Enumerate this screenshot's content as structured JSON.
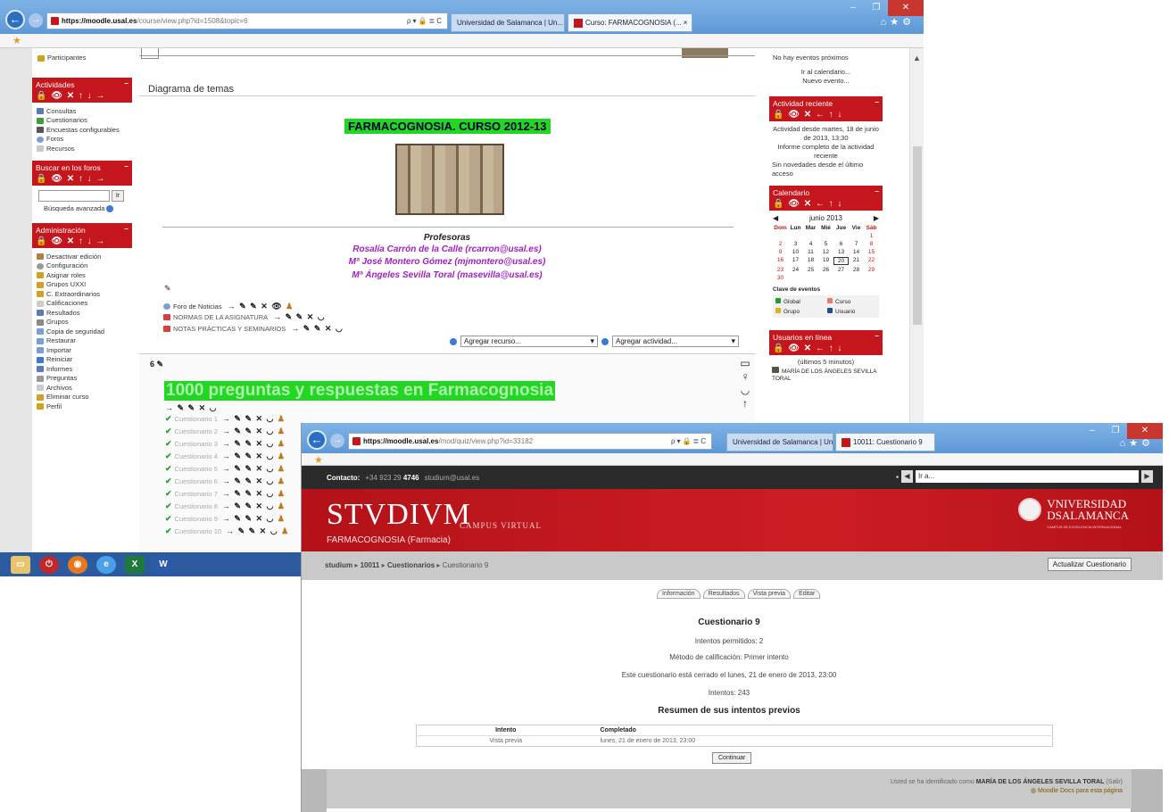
{
  "browser1": {
    "url_host": "https://moodle.usal.es",
    "url_path": "/course/view.php?id=1508&topic=6",
    "addr_ctrls": "ρ▾🔒≣C",
    "tab1": "Universidad de Salamanca | Un...",
    "tab2": "Curso: FARMACOGNOSIA (...  ×"
  },
  "left": {
    "participants": "Participantes",
    "actividades_title": "Actividades",
    "actividades": [
      "Consultas",
      "Cuestionarios",
      "Encuestas configurables",
      "Foros",
      "Recursos"
    ],
    "buscar_title": "Buscar en los foros",
    "search_btn": "Ir",
    "advanced_search": "Búsqueda avanzada",
    "admin_title": "Administración",
    "admin_items": [
      "Desactivar edición",
      "Configuración",
      "Asignar roles",
      "Grupos UXXI",
      "C. Extraordinarios",
      "Calificaciones",
      "Resultados",
      "Grupos",
      "Copia de seguridad",
      "Restaurar",
      "Importar",
      "Reiniciar",
      "Informes",
      "Preguntas",
      "Archivos",
      "Eliminar curso",
      "Perfil"
    ]
  },
  "center": {
    "section_title": "Diagrama de temas",
    "course_title": "FARMACOGNOSIA. CURSO 2012-13",
    "profesoras_label": "Profesoras",
    "profesoras": [
      "Rosalía Carrón de la Calle (rcarron@usal.es)",
      "Mª José Montero Gómez (mjmontero@usal.es)",
      "Mª Ángeles Sevilla Toral (masevilla@usal.es)"
    ],
    "resources": [
      "Foro de Noticias",
      "NORMAS DE LA ASIGNATURA",
      "NOTAS PRÁCTICAS Y SEMINARIOS"
    ],
    "add_resource": "Agregar recurso...",
    "add_activity": "Agregar actividad...",
    "section_num": "6",
    "section6_title": "1000 preguntas y respuestas en Farmacognosia",
    "quizzes": [
      "Cuestionario 1",
      "Cuestionario 2",
      "Cuestionario 3",
      "Cuestionario 4",
      "Cuestionario 5",
      "Cuestionario 6",
      "Cuestionario 7",
      "Cuestionario 8",
      "Cuestionario 9",
      "Cuestionario 10"
    ]
  },
  "right": {
    "no_events": "No hay eventos próximos",
    "go_calendar": "Ir al calendario...",
    "new_event": "Nuevo evento...",
    "recent_title": "Actividad reciente",
    "recent_since": "Actividad desde martes, 18 de junio de 2013, 13:30",
    "recent_report": "Informe completo de la actividad reciente",
    "recent_none": "Sin novedades desde el último acceso",
    "calendar_title": "Calendario",
    "month": "junio 2013",
    "days_hdr": [
      "Dom",
      "Lun",
      "Mar",
      "Mié",
      "Jue",
      "Vie",
      "Sáb"
    ],
    "legend_title": "Clave de eventos",
    "legend": [
      "Global",
      "Curso",
      "Grupo",
      "Usuario"
    ],
    "online_title": "Usuarios en línea",
    "online_sub": "(últimos 5 minutos)",
    "online_user": "MARÍA DE LOS ÁNGELES SEVILLA TORAL"
  },
  "browser2": {
    "url_host": "https://moodle.usal.es",
    "url_path": "/mod/quiz/view.php?id=33182",
    "tab1": "Universidad de Salamanca | Un...",
    "tab2": "10011: Cuestionario 9"
  },
  "studium": {
    "contact_label": "Contacto:",
    "phone_prefix": "+34 923 29",
    "phone_suffix": "4746",
    "email": "studium@usal.es",
    "goto_value": "Ir a...",
    "logo": "STVDIVM",
    "logo_sub": "CAMPUS VIRTUAL",
    "course": "FARMACOGNOSIA (Farmacia)",
    "usal_line1": "VNIVERSIDAD",
    "usal_line2": "DSALAMANCA",
    "usal_tag": "CAMPUS DE EXCELENCIA INTERNACIONAL",
    "crumb_home": "studium",
    "crumb_course": "10011",
    "crumb_mod": "Cuestionarios",
    "crumb_item": "Cuestionario 9",
    "update_btn": "Actualizar Cuestionario",
    "tabs": [
      "Información",
      "Resultados",
      "Vista previa",
      "Editar"
    ],
    "quiz_title": "Cuestionario 9",
    "attempts_allowed": "Intentos permitidos: 2",
    "grading": "Método de calificación: Primer intento",
    "closed": "Este cuestionario está cerrado el lunes, 21 de enero de 2013, 23:00",
    "attempts": "Intentos: 243",
    "summary_title": "Resumen de sus intentos previos",
    "col_attempt": "Intento",
    "col_completed": "Completado",
    "row_attempt": "Vista previa",
    "row_completed": "lunes, 21 de enero de 2013, 23:00",
    "continue": "Continuar",
    "login_text": "Usted se ha identificado como",
    "login_user": "MARÍA DE LOS ÁNGELES SEVILLA TORAL",
    "logout": "(Salir)",
    "moodle_doc": "Moodle Docs para esta página"
  },
  "colors": {
    "accent_red": "#c4161c",
    "green_highlight": "#21d721",
    "purple_names": "#a020c0",
    "taskbar": "#2b5a9e"
  }
}
